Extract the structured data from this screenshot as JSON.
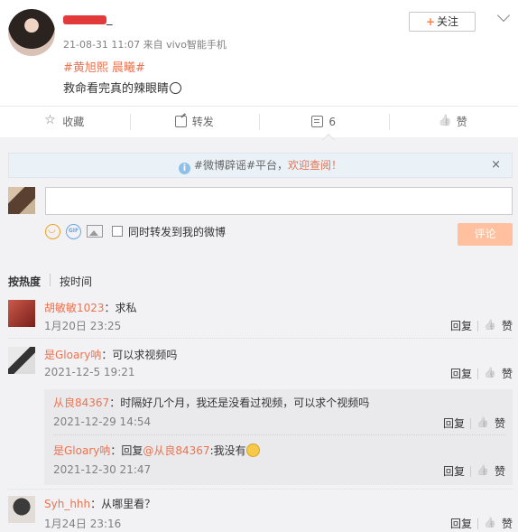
{
  "post": {
    "username_suffix": "_",
    "meta": "21-08-31 11:07 来自 vivo智能手机",
    "tags": "#黄旭熙 晨曦#",
    "text": "救命看完真的辣眼睛",
    "follow_label": "关注",
    "follow_plus": "+"
  },
  "actions": {
    "favorite": "收藏",
    "forward": "转发",
    "comment": "6",
    "like": "赞"
  },
  "notice": {
    "prefix": "#微博辟谣#平台，",
    "link": "欢迎查阅！",
    "close": "×",
    "info_glyph": "i"
  },
  "composer": {
    "gif_text": "GIF",
    "checkbox_label": "同时转发到我的微博",
    "submit": "评论"
  },
  "sort": {
    "hot": "按热度",
    "time": "按时间"
  },
  "comments": [
    {
      "name": "胡敏敏1023",
      "text": "：求私",
      "date": "1月20日 23:25",
      "reply": "回复",
      "like": "赞"
    },
    {
      "name": "是Gloary呐",
      "text": "：可以求视频吗",
      "date": "2021-12-5 19:21",
      "reply": "回复",
      "like": "赞",
      "replies": [
        {
          "name": "从良84367",
          "text": "：时隔好几个月，我还是没看过视频，可以求个视频吗",
          "date": "2021-12-29 14:54",
          "reply": "回复",
          "like": "赞"
        },
        {
          "name": "是Gloary呐",
          "text_prefix": "：回复",
          "mention": "@从良84367",
          "text_suffix": ":我没有",
          "date": "2021-12-30 21:47",
          "reply": "回复",
          "like": "赞"
        }
      ]
    },
    {
      "name": "Syh_hhh",
      "text": "：从哪里看？",
      "date": "1月24日 23:16",
      "reply": "回复",
      "like": "赞"
    }
  ]
}
